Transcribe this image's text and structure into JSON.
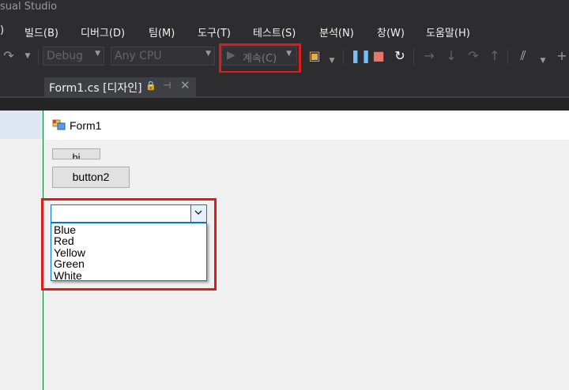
{
  "title_bar": {
    "text": "sual Studio"
  },
  "menu": {
    "items": [
      "빌드(B)",
      "디버그(D)",
      "팀(M)",
      "도구(T)",
      "테스트(S)",
      "분석(N)",
      "창(W)",
      "도움말(H)"
    ],
    "partial_first": ")"
  },
  "toolbar": {
    "config": "Debug",
    "platform": "Any CPU",
    "continue_label": "계속(C)"
  },
  "tab": {
    "title": "Form1.cs [디자인]"
  },
  "form": {
    "title": "Form1",
    "button1_label": "hi",
    "button2_label": "button2",
    "combobox_value": "",
    "dropdown_items": [
      "Blue",
      "Red",
      "Yellow",
      "Green",
      "White"
    ]
  },
  "colors": {
    "highlight_box": "#e01b1b",
    "selection_border": "#0078d7",
    "pause": "#75beff",
    "stop": "#e8756b"
  }
}
